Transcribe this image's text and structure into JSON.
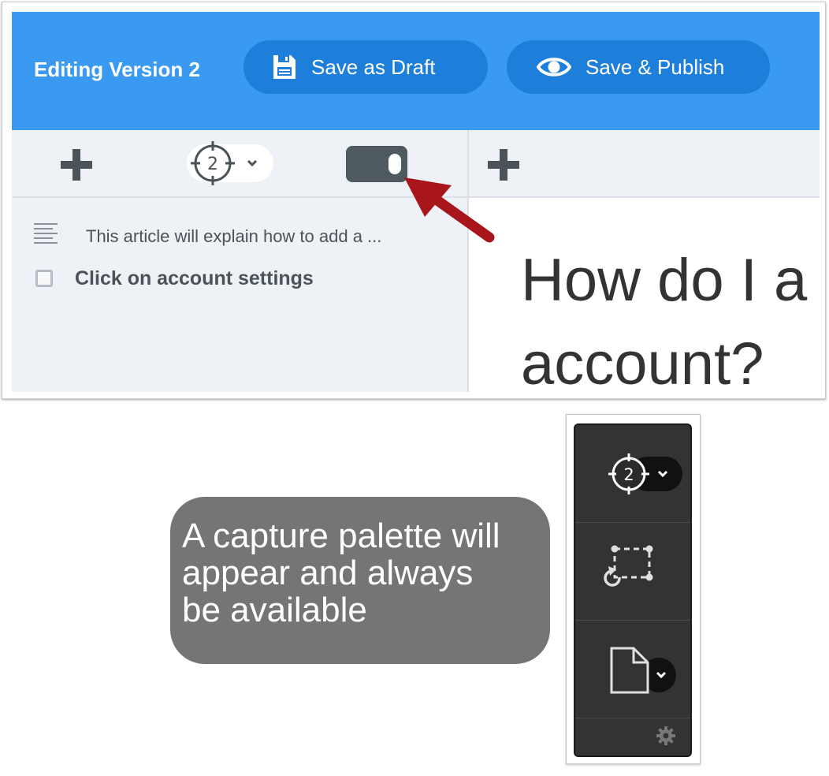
{
  "header": {
    "title": "Editing Version 2",
    "save_draft_label": "Save as Draft",
    "save_publish_label": "Save & Publish"
  },
  "editor": {
    "target_count": "2",
    "steps": [
      {
        "icon": "text-lines-icon",
        "text": "This article will explain how to add a ..."
      },
      {
        "icon": "checkbox-icon",
        "text": "Click on account settings"
      }
    ],
    "article_heading_line1": "How do I a",
    "article_heading_line2": "account?"
  },
  "callout": {
    "line1": "A capture palette will",
    "line2": "appear and always",
    "line3": "be available"
  },
  "palette": {
    "target_count": "2",
    "tools": [
      "target-capture-icon",
      "region-capture-icon",
      "page-capture-icon",
      "gear-icon"
    ]
  },
  "colors": {
    "header_blue": "#3a99f0",
    "button_blue": "#1e7fda",
    "panel_bg": "#eef1f5",
    "arrow_red": "#a8151a",
    "callout_gray": "#757575",
    "palette_bg": "#333333"
  }
}
